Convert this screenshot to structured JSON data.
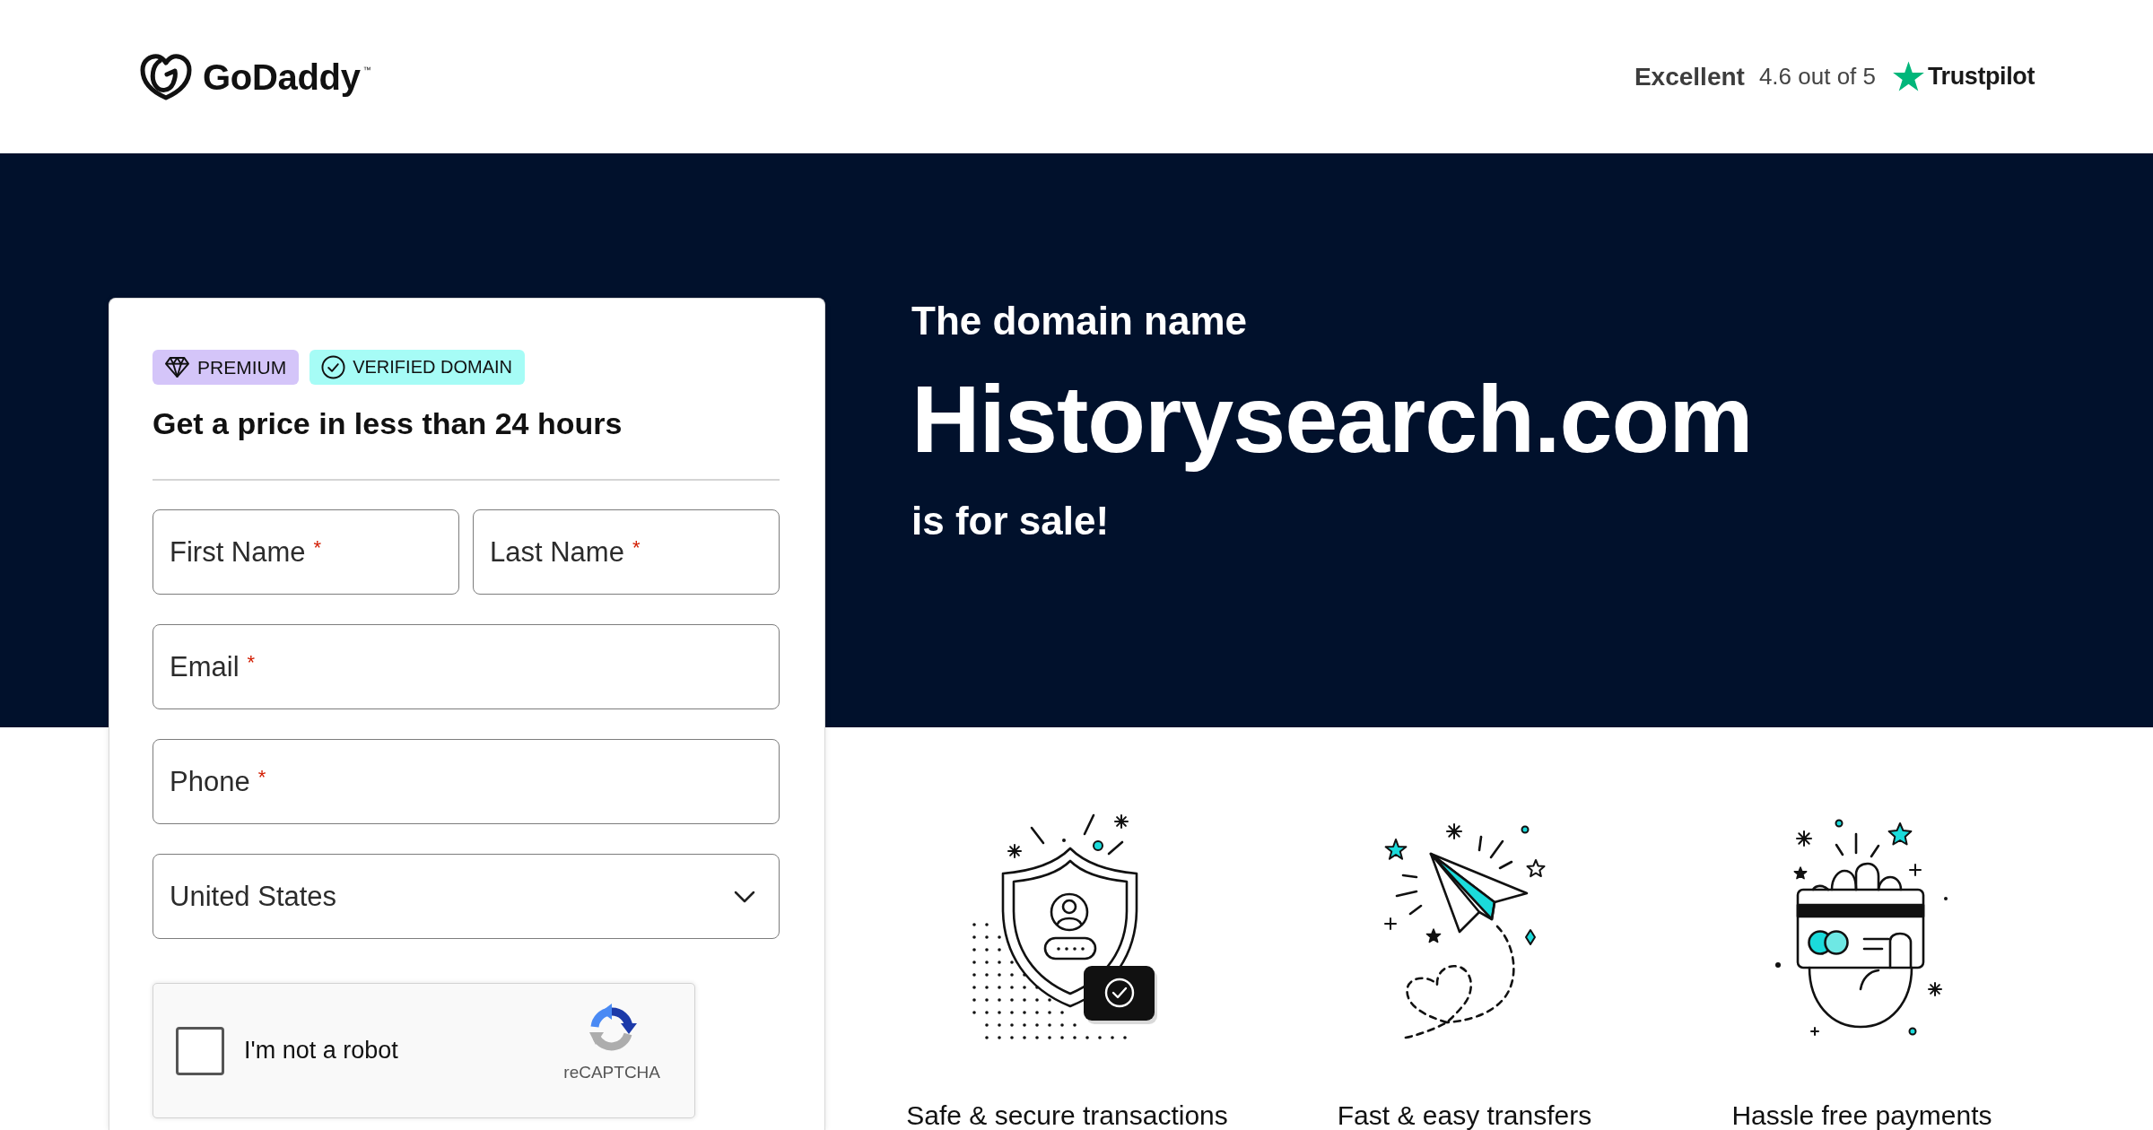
{
  "header": {
    "logo_text": "GoDaddy",
    "trademark": "™",
    "rating": {
      "label": "Excellent",
      "score": "4.6 out of 5",
      "brand": "Trustpilot"
    }
  },
  "hero": {
    "intro": "The domain name",
    "domain": "Historysearch.com",
    "outro": "is for sale!"
  },
  "form": {
    "badges": [
      {
        "kind": "premium",
        "label": "PREMIUM",
        "color": "#d4c5f9"
      },
      {
        "kind": "verified",
        "label": "VERIFIED DOMAIN",
        "color": "#a6fcf6"
      }
    ],
    "title": "Get a price in less than 24 hours",
    "rows": [
      [
        {
          "kind": "text",
          "label": "First Name",
          "required_mark": "*"
        },
        {
          "kind": "text",
          "label": "Last Name",
          "required_mark": "*"
        }
      ],
      [
        {
          "kind": "text",
          "label": "Email",
          "required_mark": "*"
        }
      ],
      [
        {
          "kind": "text",
          "label": "Phone",
          "required_mark": "*"
        }
      ],
      [
        {
          "kind": "select",
          "value": "United States"
        }
      ]
    ],
    "captcha": {
      "label": "I'm not a robot",
      "checked": false,
      "brand": "reCAPTCHA"
    }
  },
  "features": [
    {
      "kind": "shield",
      "label": "Safe & secure transactions"
    },
    {
      "kind": "plane",
      "label": "Fast & easy transfers"
    },
    {
      "kind": "card",
      "label": "Hassle free payments"
    }
  ]
}
